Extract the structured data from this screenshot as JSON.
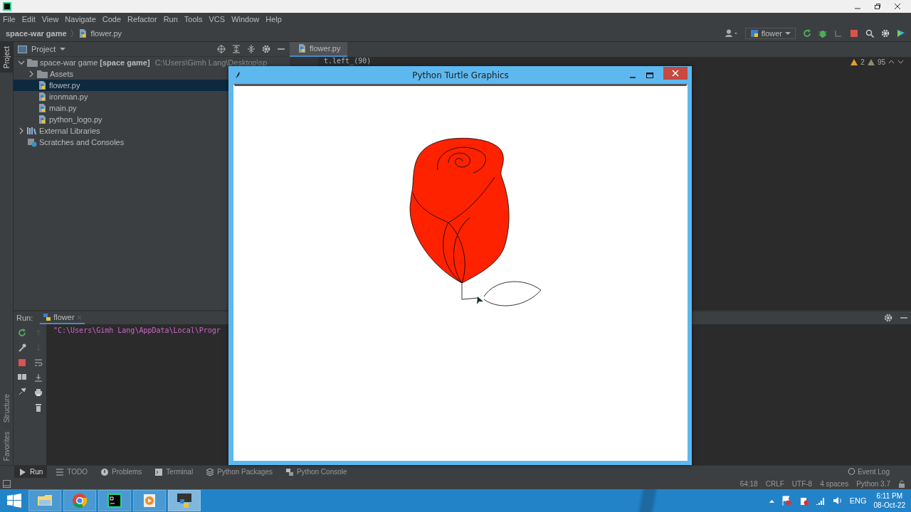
{
  "side_stripe": [
    {
      "label": "Project",
      "selected": true
    },
    {
      "label": "Structure",
      "selected": false
    },
    {
      "label": "Favorites",
      "selected": false
    }
  ],
  "menu": [
    "File",
    "Edit",
    "View",
    "Navigate",
    "Code",
    "Refactor",
    "Run",
    "Tools",
    "VCS",
    "Window",
    "Help"
  ],
  "breadcrumb": [
    "space-war game",
    "flower.py"
  ],
  "run_config": "flower",
  "project_panel": {
    "title": "Project",
    "tree": [
      {
        "label": "space-war game",
        "module": "[space game]",
        "path": "C:\\Users\\Gimh Lang\\Desktop\\sp",
        "kind": "folder",
        "expanded": true,
        "selected": false,
        "children": [
          {
            "label": "Assets",
            "kind": "folder",
            "expanded": false,
            "selected": false
          },
          {
            "label": "flower.py",
            "kind": "python",
            "selected": true
          },
          {
            "label": "ironman.py",
            "kind": "python",
            "selected": false
          },
          {
            "label": "main.py",
            "kind": "python",
            "selected": false
          },
          {
            "label": "python_logo.py",
            "kind": "python",
            "selected": false
          }
        ]
      },
      {
        "label": "External Libraries",
        "kind": "library",
        "expanded": false,
        "selected": false
      },
      {
        "label": "Scratches and Consoles",
        "kind": "scratch",
        "selected": false
      }
    ]
  },
  "editor": {
    "tabs": [
      {
        "label": "flower.py",
        "selected": true
      }
    ],
    "code_fragment": "t.left_(90)",
    "warnings": "2",
    "weak_warnings": "95"
  },
  "run_panel": {
    "label": "Run:",
    "tabs": [
      {
        "label": "flower",
        "selected": true
      }
    ],
    "output": "\"C:\\Users\\Gimh Lang\\AppData\\Local\\Progr"
  },
  "tool_tabs": [
    {
      "label": "Run",
      "kind": "run",
      "selected": true
    },
    {
      "label": "TODO",
      "kind": "todo",
      "selected": false
    },
    {
      "label": "Problems",
      "kind": "problems",
      "selected": false
    },
    {
      "label": "Terminal",
      "kind": "terminal",
      "selected": false
    },
    {
      "label": "Python Packages",
      "kind": "packages",
      "selected": false
    },
    {
      "label": "Python Console",
      "kind": "console",
      "selected": false
    }
  ],
  "event_log": "Event Log",
  "status_bar": [
    "64:18",
    "CRLF",
    "UTF-8",
    "4 spaces",
    "Python 3.7"
  ],
  "turtle_window": {
    "title": "Python Turtle Graphics"
  },
  "taskbar": {
    "apps": [
      {
        "kind": "explorer",
        "selected": false
      },
      {
        "kind": "chrome",
        "selected": false
      },
      {
        "kind": "pycharm",
        "selected": false
      },
      {
        "kind": "media",
        "selected": false
      },
      {
        "kind": "python",
        "selected": true
      }
    ],
    "language": "ENG",
    "time": "6:11 PM",
    "date": "08-Oct-22"
  }
}
